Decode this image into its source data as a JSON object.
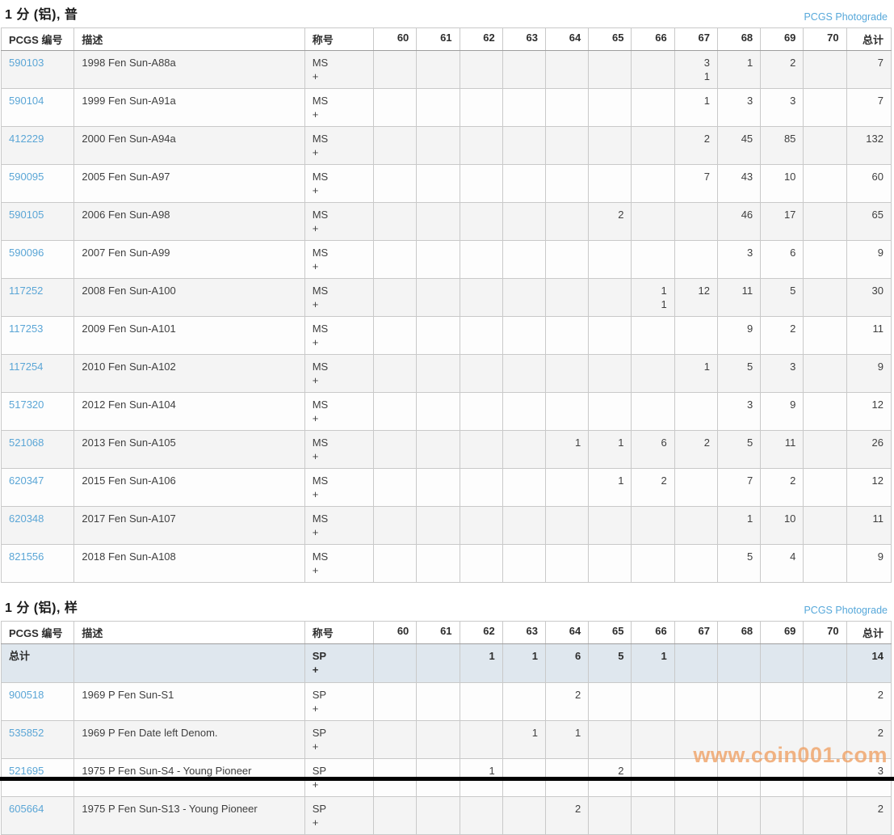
{
  "watermark": "www.coin001.com",
  "grade_keys": [
    "60",
    "61",
    "62",
    "63",
    "64",
    "65",
    "66",
    "67",
    "68",
    "69",
    "70"
  ],
  "tables": [
    {
      "title": "1 分 (铝), 普",
      "photograde_link": "PCGS Photograde",
      "columns": [
        "PCGS 编号",
        "描述",
        "称号",
        "60",
        "61",
        "62",
        "63",
        "64",
        "65",
        "66",
        "67",
        "68",
        "69",
        "70",
        "总计"
      ],
      "rows": [
        {
          "id": "590103",
          "desc": "1998 Fen Sun-A88a",
          "designation": [
            "MS",
            "+"
          ],
          "grades": {
            "67": [
              "3",
              "1"
            ],
            "68": [
              "1"
            ],
            "69": [
              "2"
            ]
          },
          "total": "7"
        },
        {
          "id": "590104",
          "desc": "1999 Fen Sun-A91a",
          "designation": [
            "MS",
            "+"
          ],
          "grades": {
            "67": [
              "1"
            ],
            "68": [
              "3"
            ],
            "69": [
              "3"
            ]
          },
          "total": "7"
        },
        {
          "id": "412229",
          "desc": "2000 Fen Sun-A94a",
          "designation": [
            "MS",
            "+"
          ],
          "grades": {
            "67": [
              "2"
            ],
            "68": [
              "45"
            ],
            "69": [
              "85"
            ]
          },
          "total": "132"
        },
        {
          "id": "590095",
          "desc": "2005 Fen Sun-A97",
          "designation": [
            "MS",
            "+"
          ],
          "grades": {
            "67": [
              "7"
            ],
            "68": [
              "43"
            ],
            "69": [
              "10"
            ]
          },
          "total": "60"
        },
        {
          "id": "590105",
          "desc": "2006 Fen Sun-A98",
          "designation": [
            "MS",
            "+"
          ],
          "grades": {
            "65": [
              "2"
            ],
            "68": [
              "46"
            ],
            "69": [
              "17"
            ]
          },
          "total": "65"
        },
        {
          "id": "590096",
          "desc": "2007 Fen Sun-A99",
          "designation": [
            "MS",
            "+"
          ],
          "grades": {
            "68": [
              "3"
            ],
            "69": [
              "6"
            ]
          },
          "total": "9"
        },
        {
          "id": "117252",
          "desc": "2008 Fen Sun-A100",
          "designation": [
            "MS",
            "+"
          ],
          "grades": {
            "66": [
              "1",
              "1"
            ],
            "67": [
              "12"
            ],
            "68": [
              "11"
            ],
            "69": [
              "5"
            ]
          },
          "total": "30"
        },
        {
          "id": "117253",
          "desc": "2009 Fen Sun-A101",
          "designation": [
            "MS",
            "+"
          ],
          "grades": {
            "68": [
              "9"
            ],
            "69": [
              "2"
            ]
          },
          "total": "11"
        },
        {
          "id": "117254",
          "desc": "2010 Fen Sun-A102",
          "designation": [
            "MS",
            "+"
          ],
          "grades": {
            "67": [
              "1"
            ],
            "68": [
              "5"
            ],
            "69": [
              "3"
            ]
          },
          "total": "9"
        },
        {
          "id": "517320",
          "desc": "2012 Fen Sun-A104",
          "designation": [
            "MS",
            "+"
          ],
          "grades": {
            "68": [
              "3"
            ],
            "69": [
              "9"
            ]
          },
          "total": "12"
        },
        {
          "id": "521068",
          "desc": "2013 Fen Sun-A105",
          "designation": [
            "MS",
            "+"
          ],
          "grades": {
            "64": [
              "1"
            ],
            "65": [
              "1"
            ],
            "66": [
              "6"
            ],
            "67": [
              "2"
            ],
            "68": [
              "5"
            ],
            "69": [
              "11"
            ]
          },
          "total": "26"
        },
        {
          "id": "620347",
          "desc": "2015 Fen Sun-A106",
          "designation": [
            "MS",
            "+"
          ],
          "grades": {
            "65": [
              "1"
            ],
            "66": [
              "2"
            ],
            "68": [
              "7"
            ],
            "69": [
              "2"
            ]
          },
          "total": "12"
        },
        {
          "id": "620348",
          "desc": "2017 Fen Sun-A107",
          "designation": [
            "MS",
            "+"
          ],
          "grades": {
            "68": [
              "1"
            ],
            "69": [
              "10"
            ]
          },
          "total": "11"
        },
        {
          "id": "821556",
          "desc": "2018 Fen Sun-A108",
          "designation": [
            "MS",
            "+"
          ],
          "grades": {
            "68": [
              "5"
            ],
            "69": [
              "4"
            ]
          },
          "total": "9"
        }
      ]
    },
    {
      "title": "1 分 (铝), 样",
      "photograde_link": "PCGS Photograde",
      "columns": [
        "PCGS 编号",
        "描述",
        "称号",
        "60",
        "61",
        "62",
        "63",
        "64",
        "65",
        "66",
        "67",
        "68",
        "69",
        "70",
        "总计"
      ],
      "rows": [
        {
          "id": "总计",
          "desc": "",
          "designation": [
            "SP",
            "+"
          ],
          "grades": {
            "62": [
              "1"
            ],
            "63": [
              "1"
            ],
            "64": [
              "6"
            ],
            "65": [
              "5"
            ],
            "66": [
              "1"
            ]
          },
          "total": "14",
          "is_summary": true
        },
        {
          "id": "900518",
          "desc": "1969 P Fen Sun-S1",
          "designation": [
            "SP",
            "+"
          ],
          "grades": {
            "64": [
              "2"
            ]
          },
          "total": "2"
        },
        {
          "id": "535852",
          "desc": "1969 P Fen Date left Denom.",
          "designation": [
            "SP",
            "+"
          ],
          "grades": {
            "63": [
              "1"
            ],
            "64": [
              "1"
            ]
          },
          "total": "2"
        },
        {
          "id": "521695",
          "desc": "1975 P Fen Sun-S4 - Young Pioneer",
          "designation": [
            "SP",
            "+"
          ],
          "grades": {
            "62": [
              "1"
            ],
            "65": [
              "2"
            ]
          },
          "total": "3"
        },
        {
          "id": "605664",
          "desc": "1975 P Fen Sun-S13 - Young Pioneer",
          "designation": [
            "SP",
            "+"
          ],
          "grades": {
            "64": [
              "2"
            ]
          },
          "total": "2"
        }
      ]
    }
  ]
}
